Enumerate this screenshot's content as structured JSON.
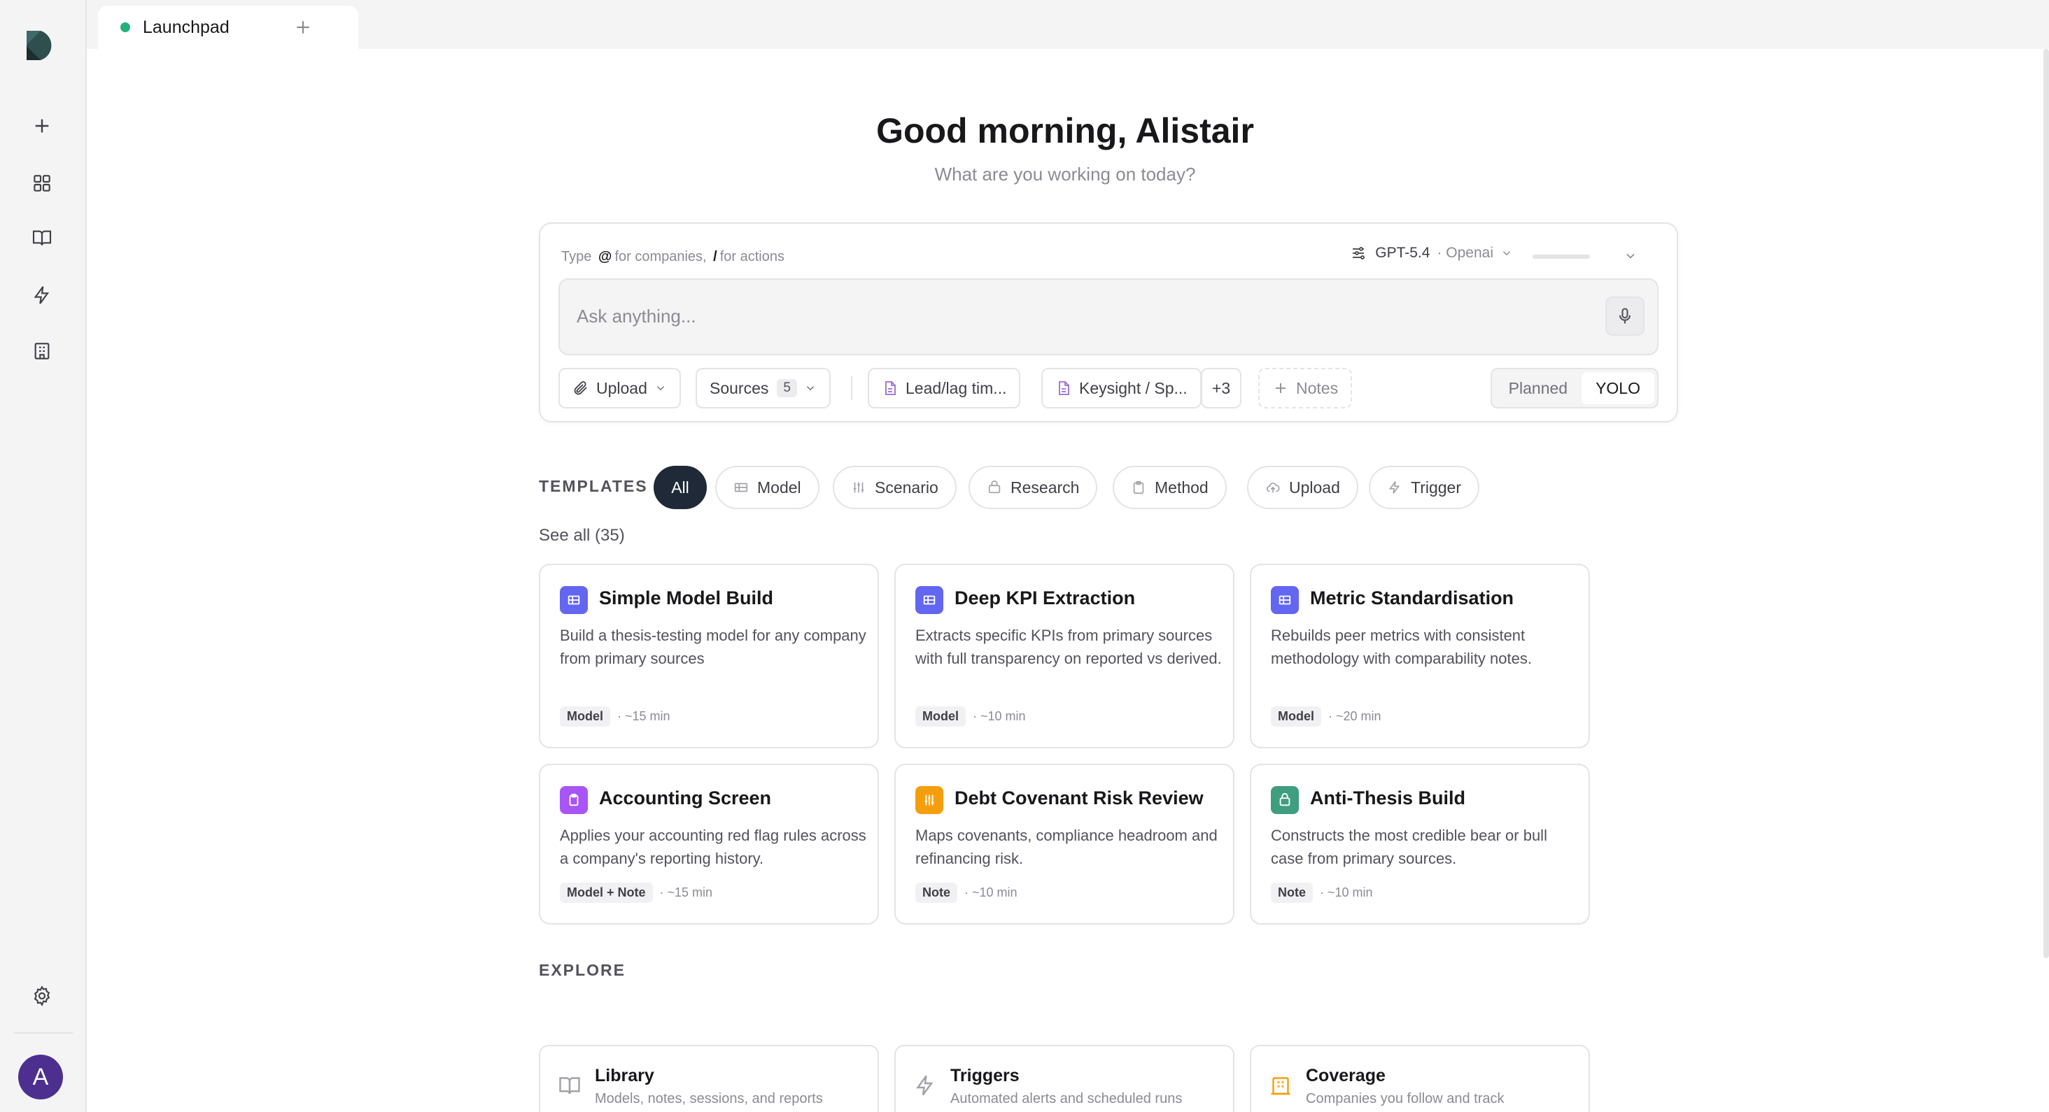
{
  "tabs": [
    {
      "label": "Launchpad",
      "active": true
    }
  ],
  "header": {
    "greeting": "Good morning, Alistair",
    "subtitle": "What are you working on today?"
  },
  "composer": {
    "hint_type": "Type",
    "hint_at": "@",
    "hint_companies": "for companies,",
    "hint_slash": "/",
    "hint_actions": "for actions",
    "model": "GPT-5.4",
    "provider": "Openai",
    "placeholder": "Ask anything...",
    "upload": "Upload",
    "sources": "Sources",
    "sources_count": "5",
    "attachments": [
      "Lead/lag tim...",
      "Keysight / Sp..."
    ],
    "more": "+3",
    "notes": "Notes",
    "modes": [
      "Planned",
      "YOLO"
    ],
    "active_mode": "YOLO"
  },
  "templates": {
    "label": "TEMPLATES",
    "filters": [
      "All",
      "Model",
      "Scenario",
      "Research",
      "Method",
      "Upload",
      "Trigger"
    ],
    "active_filter": "All",
    "see_all": "See all (35)",
    "cards": [
      {
        "title": "Simple Model Build",
        "desc": "Build a thesis-testing model for any company from primary sources",
        "tag": "Model",
        "time": "· ~15 min",
        "color": "#6366f1"
      },
      {
        "title": "Deep KPI Extraction",
        "desc": "Extracts specific KPIs from primary sources with full transparency on reported vs derived.",
        "tag": "Model",
        "time": "· ~10 min",
        "color": "#6366f1"
      },
      {
        "title": "Metric Standardisation",
        "desc": "Rebuilds peer metrics with consistent methodology with comparability notes.",
        "tag": "Model",
        "time": "· ~20 min",
        "color": "#6366f1"
      },
      {
        "title": "Accounting Screen",
        "desc": "Applies your accounting red flag rules across a company's reporting history.",
        "tag": "Model + Note",
        "time": "· ~15 min",
        "color": "#a855f7"
      },
      {
        "title": "Debt Covenant Risk Review",
        "desc": "Maps covenants, compliance headroom and refinancing risk.",
        "tag": "Note",
        "time": "· ~10 min",
        "color": "#f59e0b"
      },
      {
        "title": "Anti-Thesis Build",
        "desc": "Constructs the most credible bear or bull case from primary sources.",
        "tag": "Note",
        "time": "· ~10 min",
        "color": "#3f9e7f"
      }
    ]
  },
  "explore": {
    "label": "EXPLORE",
    "items": [
      {
        "title": "Library",
        "desc": "Models, notes, sessions, and reports"
      },
      {
        "title": "Triggers",
        "desc": "Automated alerts and scheduled runs"
      },
      {
        "title": "Coverage",
        "desc": "Companies you follow and track"
      }
    ]
  },
  "user": {
    "initial": "A"
  }
}
